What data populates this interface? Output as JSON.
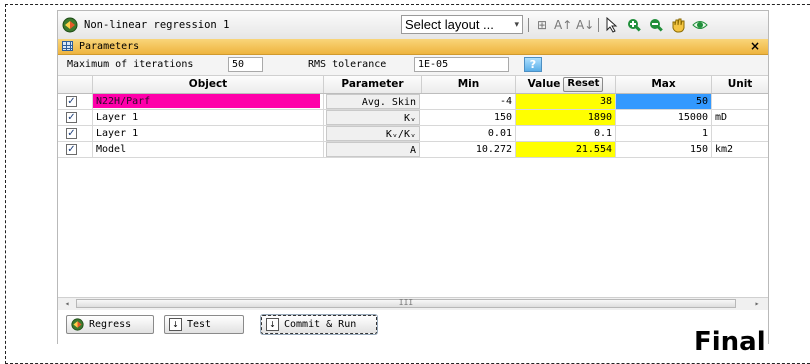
{
  "window": {
    "title": "Non-linear regression 1"
  },
  "toolbar": {
    "layout_select": "Select layout ...",
    "icons": [
      "table-abc-icon",
      "font-bigger-icon",
      "font-smaller-icon",
      "pointer-icon",
      "zoom-in-icon",
      "zoom-out-icon",
      "hand-icon",
      "eye-icon"
    ]
  },
  "panel": {
    "title": "Parameters",
    "close_label": "×"
  },
  "settings": {
    "max_iter_label": "Maximum of iterations",
    "max_iter_value": "50",
    "rms_label": "RMS tolerance",
    "rms_value": "1E-05",
    "help_label": "?"
  },
  "table": {
    "headers": {
      "object": "Object",
      "parameter": "Parameter",
      "min": "Min",
      "value": "Value",
      "reset": "Reset",
      "max": "Max",
      "unit": "Unit"
    },
    "rows": [
      {
        "checked": true,
        "object": "N22H/Parf",
        "parameter": "Avg. Skin",
        "min": "-4",
        "value": "38",
        "max": "50",
        "unit": ""
      },
      {
        "checked": true,
        "object": "Layer 1",
        "parameter": "Kᵥ",
        "min": "150",
        "value": "1890",
        "max": "15000",
        "unit": "mD"
      },
      {
        "checked": true,
        "object": "Layer 1",
        "parameter": "Kᵥ/Kᵥ",
        "min": "0.01",
        "value": "0.1",
        "max": "1",
        "unit": ""
      },
      {
        "checked": true,
        "object": "Model",
        "parameter": "A",
        "min": "10.272",
        "value": "21.554",
        "max": "150",
        "unit": "km2"
      }
    ]
  },
  "scrollbar": {
    "grip": "III"
  },
  "buttons": {
    "regress": "Regress",
    "test": "Test",
    "commit_run": "Commit & Run"
  },
  "overlay": {
    "final_text": "Final"
  },
  "colors": {
    "accent_header": "#eeb43f",
    "highlight_yellow": "#ffff00",
    "highlight_blue": "#3399ff",
    "highlight_magenta": "#ff00aa"
  }
}
